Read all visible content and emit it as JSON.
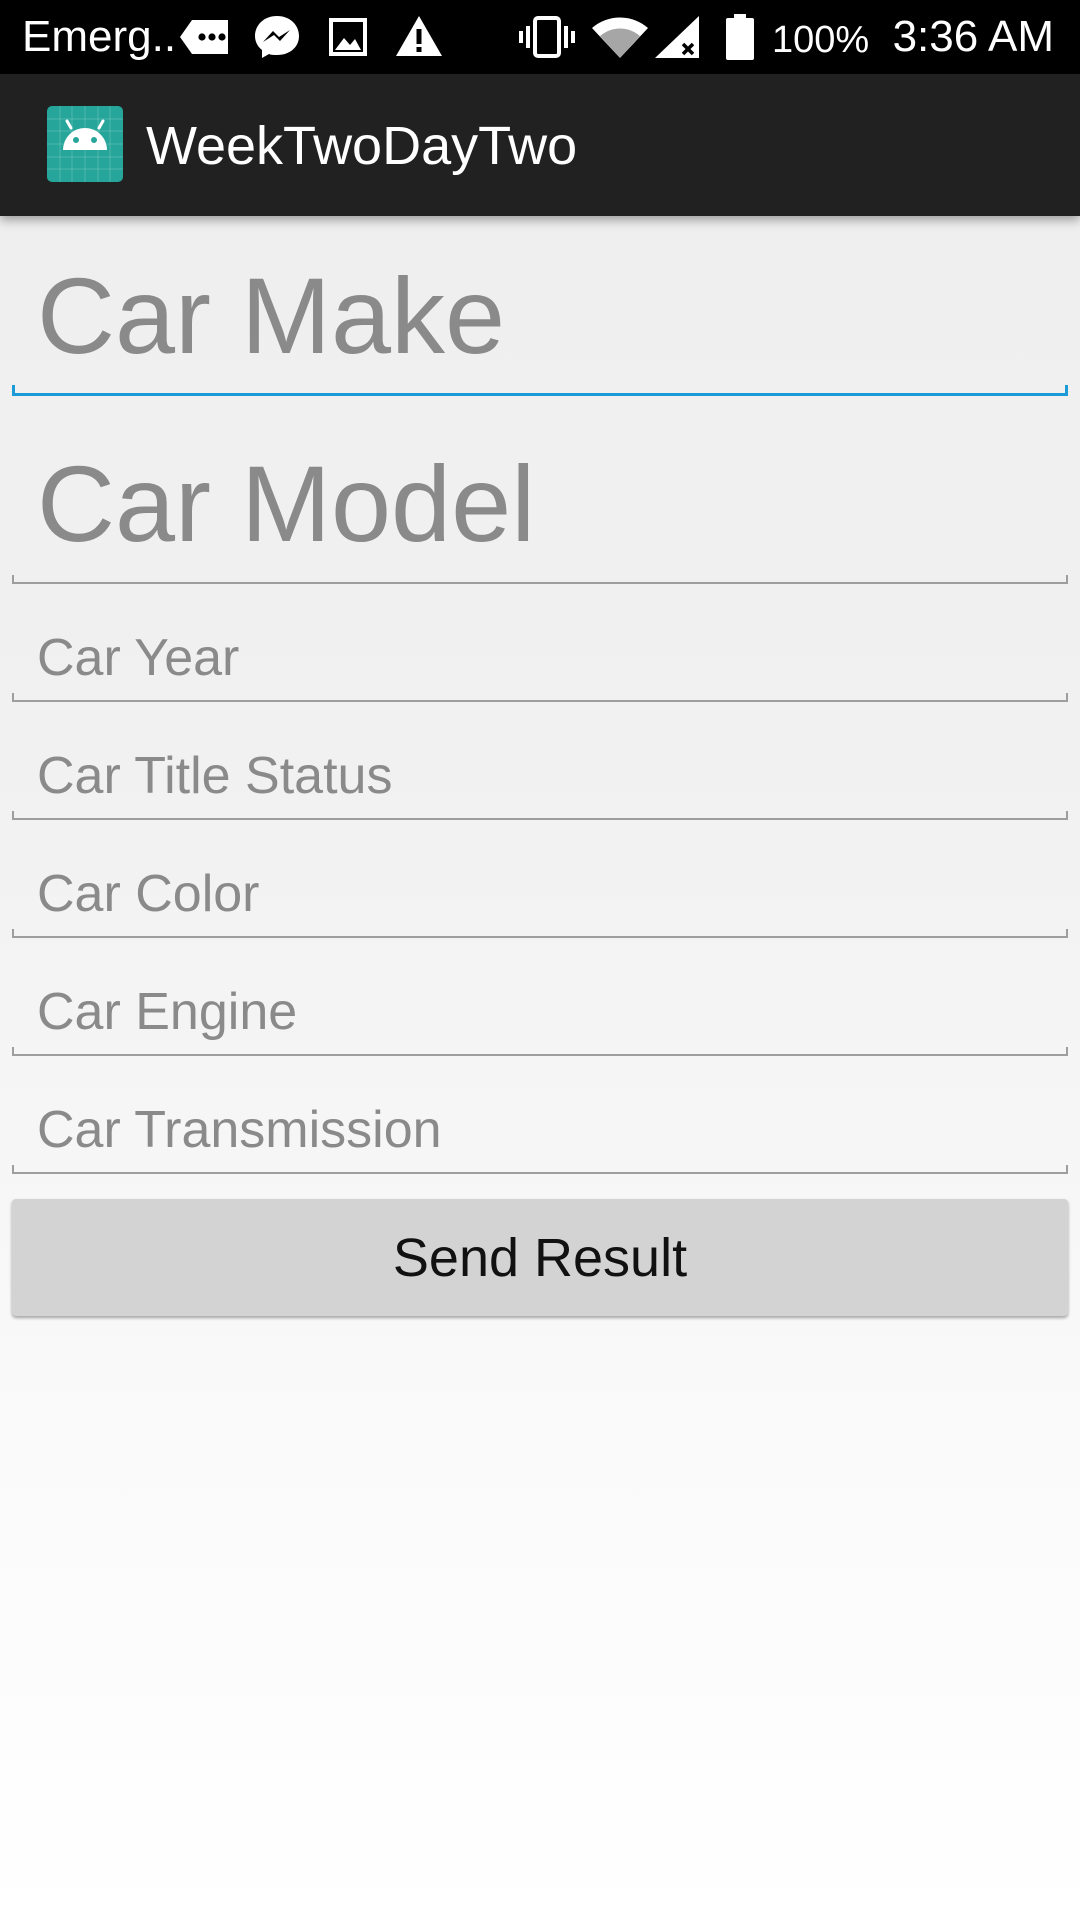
{
  "status_bar": {
    "carrier": "Emerg..",
    "battery_percent": "100%",
    "time": "3:36 AM",
    "icons": [
      "sms-icon",
      "messenger-icon",
      "image-icon",
      "warning-icon",
      "vibrate-icon",
      "wifi-icon",
      "signal-icon",
      "battery-icon"
    ]
  },
  "app_bar": {
    "title": "WeekTwoDayTwo",
    "icon": "android-app-icon",
    "icon_color": "#26a69a"
  },
  "form": {
    "car_make_placeholder": "Car Make",
    "car_model_placeholder": "Car Model",
    "car_year_placeholder": "Car Year",
    "car_title_status_placeholder": "Car Title Status",
    "car_color_placeholder": "Car Color",
    "car_engine_placeholder": "Car Engine",
    "car_transmission_placeholder": "Car Transmission",
    "focused_field": "car_make",
    "accent_color": "#1a9bd7"
  },
  "send_button_label": "Send Result"
}
